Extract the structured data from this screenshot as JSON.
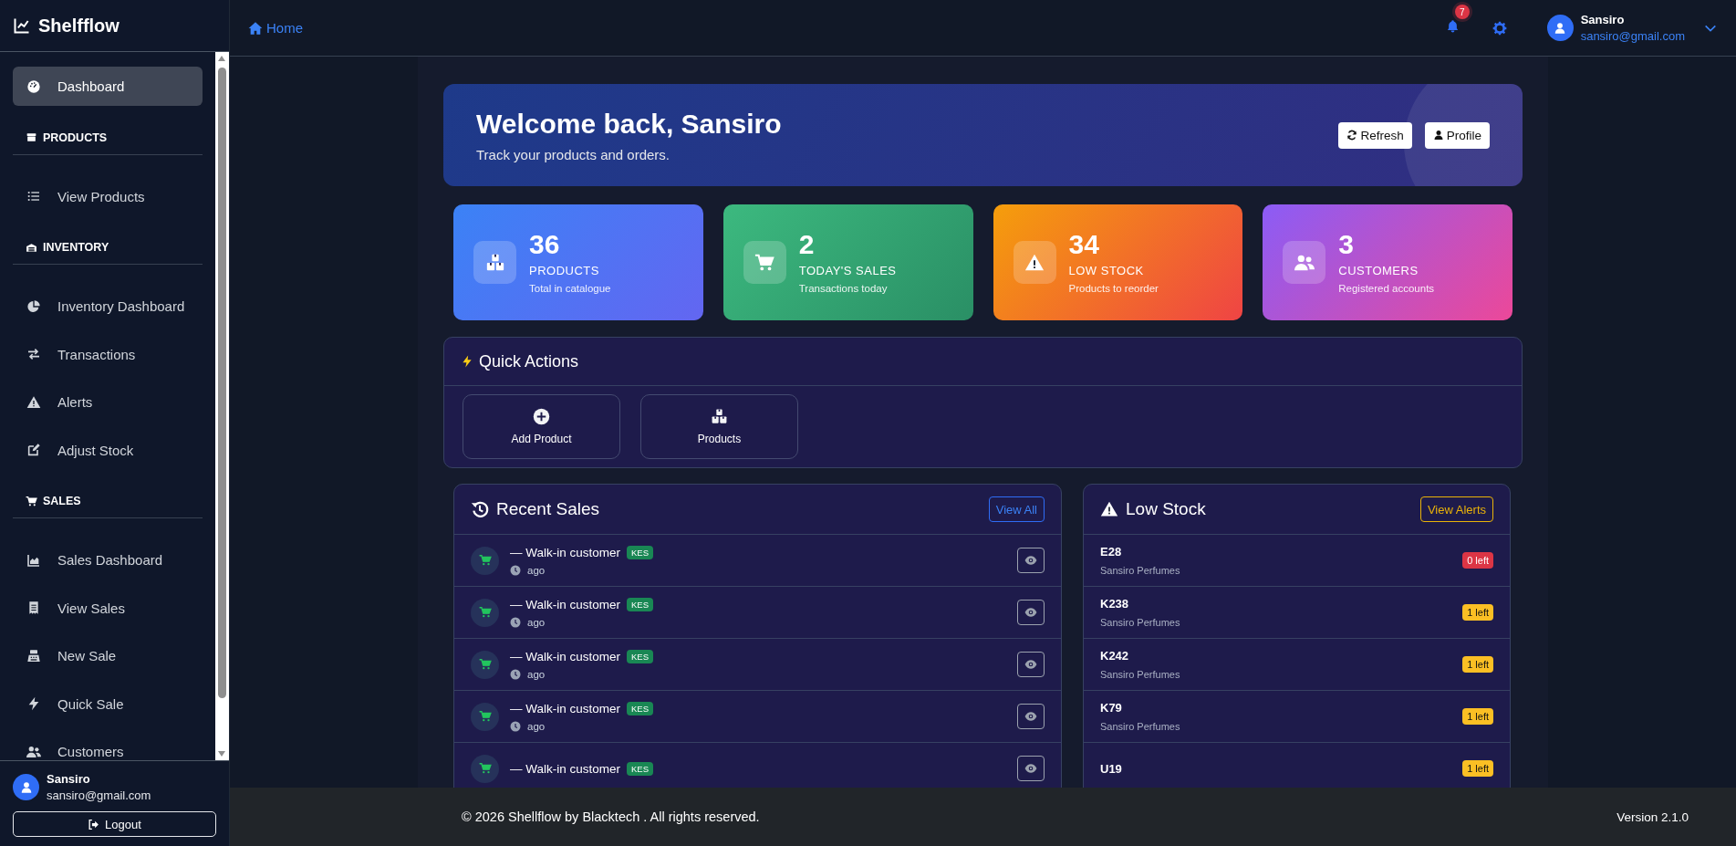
{
  "brand": {
    "name": "Shelfflow"
  },
  "sidebar": {
    "items": [
      {
        "kind": "link",
        "label": "Dashboard",
        "selected": true
      },
      {
        "kind": "section",
        "label": "PRODUCTS"
      },
      {
        "kind": "link",
        "label": "View Products",
        "selected": false
      },
      {
        "kind": "section",
        "label": "INVENTORY"
      },
      {
        "kind": "link",
        "label": "Inventory Dashboard",
        "selected": false
      },
      {
        "kind": "link",
        "label": "Transactions",
        "selected": false
      },
      {
        "kind": "link",
        "label": "Alerts",
        "selected": false
      },
      {
        "kind": "link",
        "label": "Adjust Stock",
        "selected": false
      },
      {
        "kind": "section",
        "label": "SALES"
      },
      {
        "kind": "link",
        "label": "Sales Dashboard",
        "selected": false
      },
      {
        "kind": "link",
        "label": "View Sales",
        "selected": false
      },
      {
        "kind": "link",
        "label": "New Sale",
        "selected": false
      },
      {
        "kind": "link",
        "label": "Quick Sale",
        "selected": false
      },
      {
        "kind": "link",
        "label": "Customers",
        "selected": false
      }
    ],
    "user": {
      "name": "Sansiro",
      "email": "sansiro@gmail.com"
    },
    "logout": "Logout"
  },
  "header": {
    "breadcrumb": "Home",
    "notification_count": "7",
    "user": {
      "name": "Sansiro",
      "email": "sansiro@gmail.com"
    }
  },
  "welcome": {
    "title": "Welcome back, Sansiro",
    "subtitle": "Track your products and orders.",
    "buttons": [
      "Refresh",
      "Profile"
    ]
  },
  "stats": [
    {
      "value": "36",
      "label": "PRODUCTS",
      "caption": "Total in catalogue"
    },
    {
      "value": "2",
      "label": "TODAY'S SALES",
      "caption": "Transactions today"
    },
    {
      "value": "34",
      "label": "LOW STOCK",
      "caption": "Products to reorder"
    },
    {
      "value": "3",
      "label": "CUSTOMERS",
      "caption": "Registered accounts"
    }
  ],
  "quick_actions": {
    "title": "Quick Actions",
    "actions": [
      "Add Product",
      "Products"
    ]
  },
  "recent_sales": {
    "title": "Recent Sales",
    "button": "View All",
    "rows": [
      {
        "customer": "— Walk-in customer",
        "currency": "KES",
        "time": "ago"
      },
      {
        "customer": "— Walk-in customer",
        "currency": "KES",
        "time": "ago"
      },
      {
        "customer": "— Walk-in customer",
        "currency": "KES",
        "time": "ago"
      },
      {
        "customer": "— Walk-in customer",
        "currency": "KES",
        "time": "ago"
      },
      {
        "customer": "— Walk-in customer",
        "currency": "KES"
      }
    ]
  },
  "low_stock": {
    "title": "Low Stock",
    "button": "View Alerts",
    "rows": [
      {
        "code": "E28",
        "brand": "Sansiro Perfumes",
        "stock": "0 left",
        "kind": "out"
      },
      {
        "code": "K238",
        "brand": "Sansiro Perfumes",
        "stock": "1 left",
        "kind": "low"
      },
      {
        "code": "K242",
        "brand": "Sansiro Perfumes",
        "stock": "1 left",
        "kind": "low"
      },
      {
        "code": "K79",
        "brand": "Sansiro Perfumes",
        "stock": "1 left",
        "kind": "low"
      },
      {
        "code": "U19",
        "stock": "1 left",
        "kind": "low"
      }
    ]
  },
  "footer": {
    "copyright": "© 2026 Shellflow by Blacktech . All rights reserved.",
    "version": "Version 2.1.0"
  }
}
